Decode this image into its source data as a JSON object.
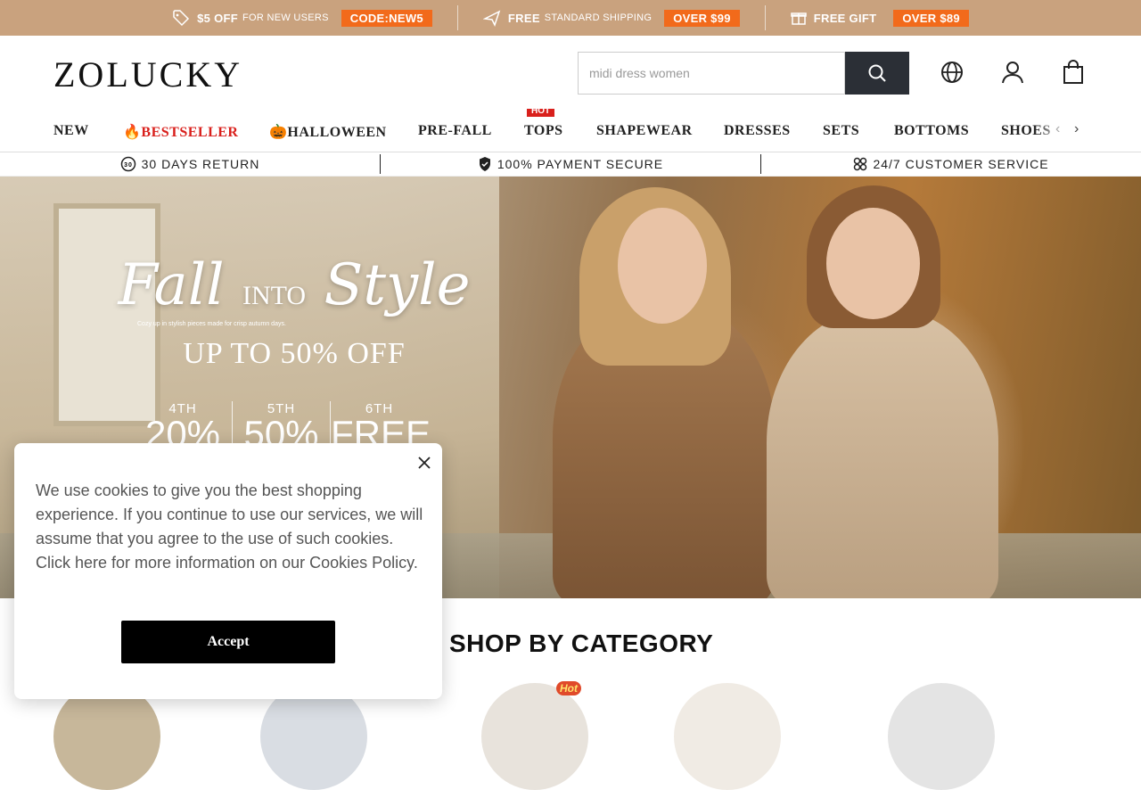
{
  "promo": {
    "items": [
      {
        "bold": "$5 OFF",
        "text": "FOR NEW USERS",
        "code": "CODE:NEW5",
        "icon": "tag-icon"
      },
      {
        "bold": "FREE",
        "text": "STANDARD SHIPPING",
        "code": "OVER $99",
        "icon": "plane-icon"
      },
      {
        "bold": "FREE GIFT",
        "text": "",
        "code": "OVER $89",
        "icon": "gift-icon"
      }
    ]
  },
  "header": {
    "logo": "ZOLUCKY",
    "search_placeholder": "midi dress women"
  },
  "nav": {
    "items": [
      "NEW",
      "🔥BESTSELLER",
      "🎃HALLOWEEN",
      "PRE-FALL",
      "TOPS",
      "SHAPEWEAR",
      "DRESSES",
      "SETS",
      "BOTTOMS",
      "SHOES"
    ],
    "hot_label": "HOT"
  },
  "trust": {
    "items": [
      "30 DAYS RETURN",
      "100% PAYMENT SECURE",
      "24/7 CUSTOMER SERVICE"
    ]
  },
  "hero": {
    "title_a": "Fall",
    "title_into": "INTO",
    "title_b": "Style",
    "subtitle": "Cozy up in stylish pieces made for crisp autumn days.",
    "offer": "UP TO 50% OFF",
    "tiers": [
      {
        "n": "4TH",
        "v": "20%"
      },
      {
        "n": "5TH",
        "v": "50%"
      },
      {
        "n": "6TH",
        "v": "FREE"
      }
    ]
  },
  "cookie": {
    "text": "We use cookies to give you the best shopping experience. If you continue to use our services, we will assume that you agree to the use of such cookies. Click here for more information on our Cookies Policy.",
    "accept": "Accept"
  },
  "category": {
    "title": "# SHOP BY CATEGORY",
    "hot_badge": "Hot"
  },
  "colors": {
    "promo_bg": "#c9a27e",
    "promo_code": "#f26a1b",
    "nav_red": "#d9201c",
    "search_btn": "#2b2f36"
  }
}
